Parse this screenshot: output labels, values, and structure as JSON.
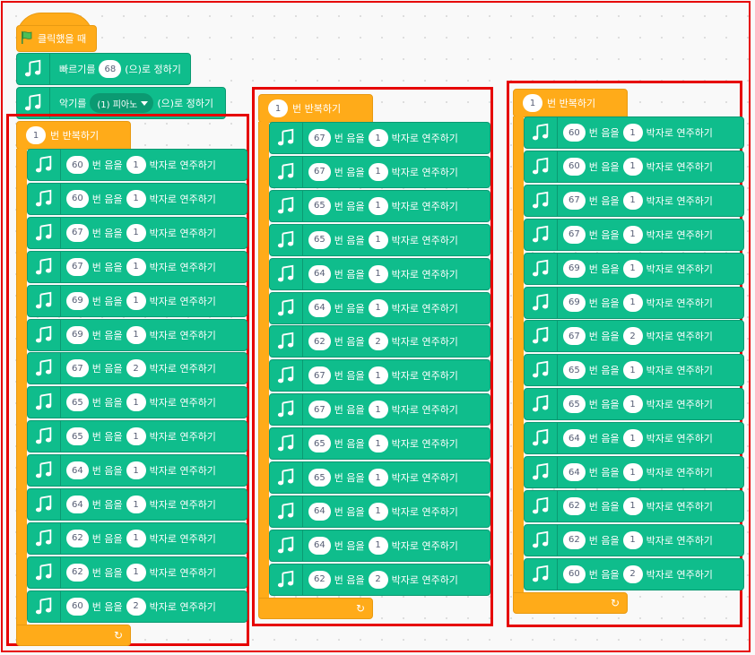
{
  "hat": {
    "label": "클릭했을 때",
    "icon": "green-flag-icon"
  },
  "tempo": {
    "prefix": "빠르기를",
    "value": "68",
    "suffix": "(으)로 정하기"
  },
  "instrument": {
    "prefix": "악기를",
    "value": "(1) 피아노",
    "suffix": "(으)로 정하기"
  },
  "repeat_label": "번 반복하기",
  "note_mid": "번 음을",
  "note_suffix": "박자로 연주하기",
  "colors": {
    "music": "#0fbd8c",
    "control": "#ffab19",
    "highlight": "#e60000"
  },
  "loops": [
    {
      "times": "1",
      "notes": [
        {
          "note": "60",
          "beats": "1"
        },
        {
          "note": "60",
          "beats": "1"
        },
        {
          "note": "67",
          "beats": "1"
        },
        {
          "note": "67",
          "beats": "1"
        },
        {
          "note": "69",
          "beats": "1"
        },
        {
          "note": "69",
          "beats": "1"
        },
        {
          "note": "67",
          "beats": "2"
        },
        {
          "note": "65",
          "beats": "1"
        },
        {
          "note": "65",
          "beats": "1"
        },
        {
          "note": "64",
          "beats": "1"
        },
        {
          "note": "64",
          "beats": "1"
        },
        {
          "note": "62",
          "beats": "1"
        },
        {
          "note": "62",
          "beats": "1"
        },
        {
          "note": "60",
          "beats": "2"
        }
      ]
    },
    {
      "times": "1",
      "notes": [
        {
          "note": "67",
          "beats": "1"
        },
        {
          "note": "67",
          "beats": "1"
        },
        {
          "note": "65",
          "beats": "1"
        },
        {
          "note": "65",
          "beats": "1"
        },
        {
          "note": "64",
          "beats": "1"
        },
        {
          "note": "64",
          "beats": "1"
        },
        {
          "note": "62",
          "beats": "2"
        },
        {
          "note": "67",
          "beats": "1"
        },
        {
          "note": "67",
          "beats": "1"
        },
        {
          "note": "65",
          "beats": "1"
        },
        {
          "note": "65",
          "beats": "1"
        },
        {
          "note": "64",
          "beats": "1"
        },
        {
          "note": "64",
          "beats": "1"
        },
        {
          "note": "62",
          "beats": "2"
        }
      ]
    },
    {
      "times": "1",
      "notes": [
        {
          "note": "60",
          "beats": "1"
        },
        {
          "note": "60",
          "beats": "1"
        },
        {
          "note": "67",
          "beats": "1"
        },
        {
          "note": "67",
          "beats": "1"
        },
        {
          "note": "69",
          "beats": "1"
        },
        {
          "note": "69",
          "beats": "1"
        },
        {
          "note": "67",
          "beats": "2"
        },
        {
          "note": "65",
          "beats": "1"
        },
        {
          "note": "65",
          "beats": "1"
        },
        {
          "note": "64",
          "beats": "1"
        },
        {
          "note": "64",
          "beats": "1"
        },
        {
          "note": "62",
          "beats": "1"
        },
        {
          "note": "62",
          "beats": "1"
        },
        {
          "note": "60",
          "beats": "2"
        }
      ]
    }
  ]
}
